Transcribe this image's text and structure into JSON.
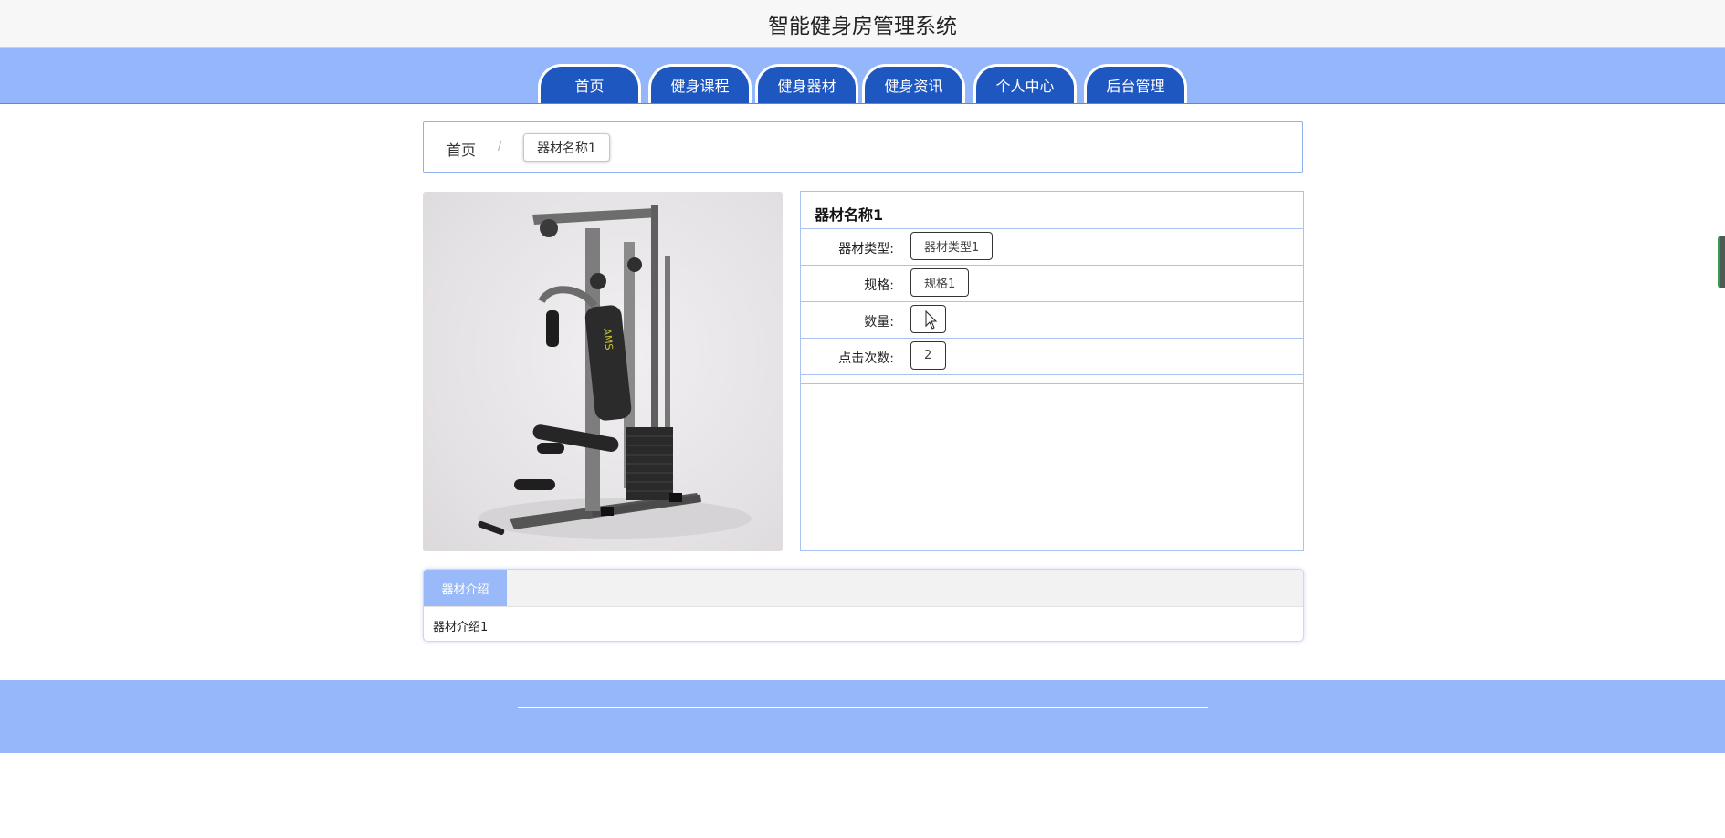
{
  "header": {
    "title": "智能健身房管理系统"
  },
  "nav": {
    "tabs": [
      {
        "label": "首页"
      },
      {
        "label": "健身课程"
      },
      {
        "label": "健身器材"
      },
      {
        "label": "健身资讯"
      },
      {
        "label": "个人中心"
      },
      {
        "label": "后台管理"
      }
    ]
  },
  "breadcrumb": {
    "home": "首页",
    "separator": "/",
    "current": "器材名称1"
  },
  "equipment": {
    "name": "器材名称1",
    "rows": [
      {
        "label": "器材类型:",
        "value": "器材类型1"
      },
      {
        "label": "规格:",
        "value": "规格1"
      },
      {
        "label": "数量:",
        "value": ""
      },
      {
        "label": "点击次数:",
        "value": "2"
      }
    ]
  },
  "intro": {
    "tab": "器材介绍",
    "text": "器材介绍1"
  },
  "colors": {
    "nav_bg": "#94b6fb",
    "tab_bg": "#1f57c1",
    "footer_bg": "#96b8fb",
    "border": "#a9c2f2"
  }
}
